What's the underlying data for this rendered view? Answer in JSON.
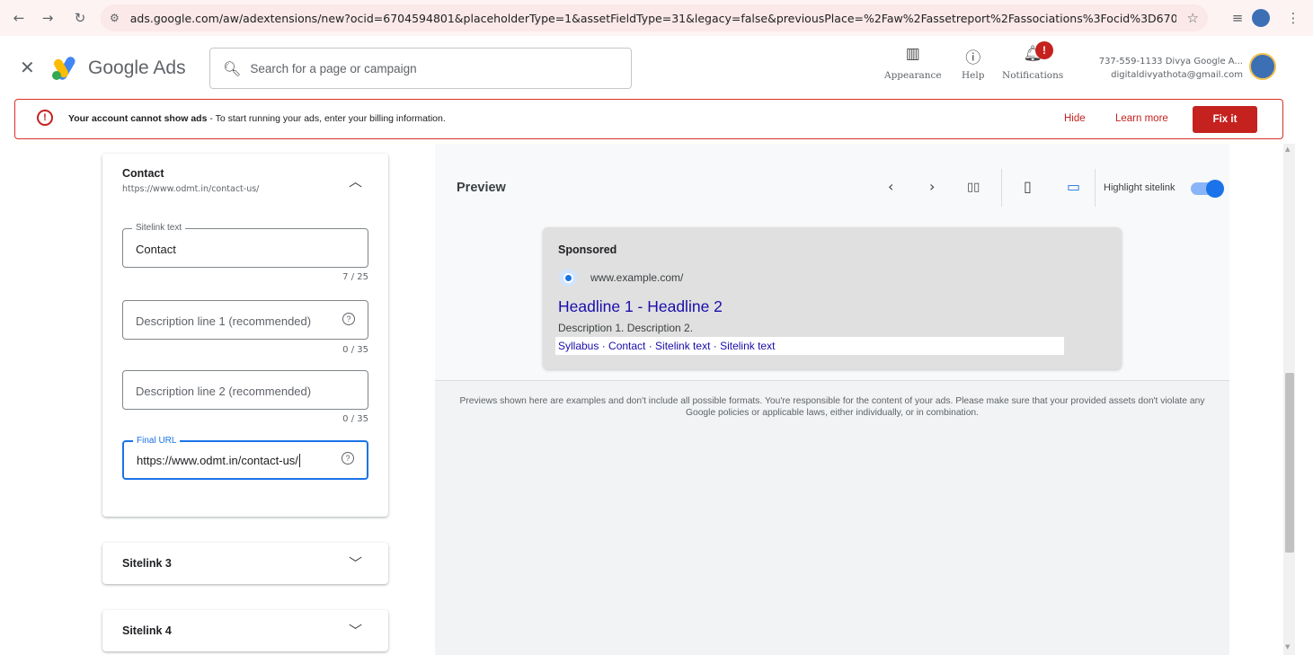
{
  "browser": {
    "url": "ads.google.com/aw/adextensions/new?ocid=6704594801&placeholderType=1&assetFieldType=31&legacy=false&previousPlace=%2Faw%2Fassetreport%2Fassociations%3Focid%3D6704594801..."
  },
  "header": {
    "brand": "Google Ads",
    "search_placeholder": "Search for a page or campaign",
    "appearance_label": "Appearance",
    "help_label": "Help",
    "notifications_label": "Notifications",
    "notification_badge": "!",
    "account_line1": "737-559-1133 Divya Google A...",
    "account_line2": "digitaldivyathota@gmail.com"
  },
  "alert": {
    "title": "Your account cannot show ads",
    "message": " - To start running your ads, enter your billing information.",
    "hide_label": "Hide",
    "learn_label": "Learn more",
    "fix_label": "Fix it"
  },
  "sitelink_card": {
    "title": "Contact",
    "url": "https://www.odmt.in/contact-us/",
    "sitelink_text_label": "Sitelink text",
    "sitelink_text_value": "Contact",
    "sitelink_text_count": "7 / 25",
    "desc1_placeholder": "Description line 1 (recommended)",
    "desc1_count": "0 / 35",
    "desc2_placeholder": "Description line 2 (recommended)",
    "desc2_count": "0 / 35",
    "final_url_label": "Final URL",
    "final_url_value": "https://www.odmt.in/contact-us/"
  },
  "collapsed_cards": [
    {
      "title": "Sitelink 3"
    },
    {
      "title": "Sitelink 4"
    }
  ],
  "preview": {
    "title": "Preview",
    "highlight_label": "Highlight sitelink",
    "highlight_on": true,
    "ad": {
      "sponsored": "Sponsored",
      "site": "www.example.com/",
      "headline": "Headline 1 - Headline 2",
      "description": "Description 1. Description 2.",
      "sitelinks": "Syllabus · Contact · Sitelink text · Sitelink text"
    },
    "disclaimer": "Previews shown here are examples and don't include all possible formats. You're responsible for the content of your ads. Please make sure that your provided assets don't violate any Google policies or applicable laws, either individually, or in combination."
  },
  "colors": {
    "accent": "#1a73e8",
    "error": "#c5221f",
    "link": "#1a0dab"
  }
}
